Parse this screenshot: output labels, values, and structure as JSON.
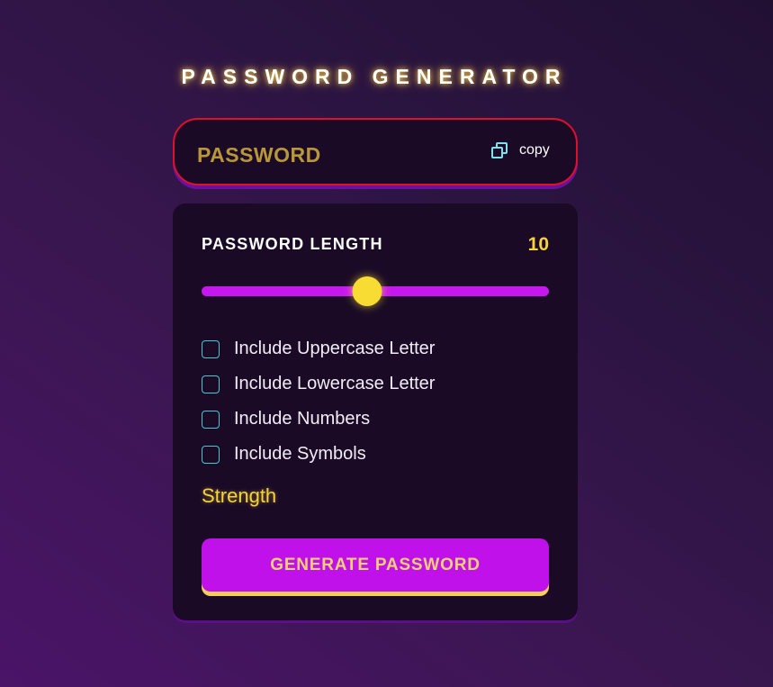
{
  "header": {
    "title": "PASSWORD GENERATOR"
  },
  "password": {
    "placeholder": "PASSWORD",
    "copy_label": "copy",
    "copy_icon": "copy-icon"
  },
  "length": {
    "label": "PASSWORD LENGTH",
    "value": "10",
    "slider_fraction": 0.476
  },
  "options": [
    {
      "label": "Include Uppercase Letter",
      "checked": false
    },
    {
      "label": "Include Lowercase Letter",
      "checked": false
    },
    {
      "label": "Include Numbers",
      "checked": false
    },
    {
      "label": "Include Symbols",
      "checked": false
    }
  ],
  "strength": {
    "label": "Strength"
  },
  "generate": {
    "label": "GENERATE PASSWORD"
  },
  "colors": {
    "accent_purple": "#c011ea",
    "accent_yellow": "#f5d33a",
    "checkbox_border": "#49c7d3",
    "border_red": "#e0102a"
  }
}
